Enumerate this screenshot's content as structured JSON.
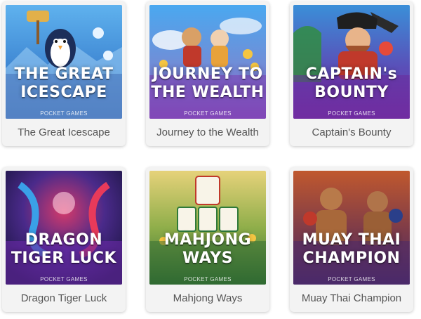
{
  "games": [
    {
      "name": "The Great Icescape",
      "art_lines": [
        "THE GREAT",
        "ICESCAPE"
      ],
      "brand": "POCKET GAMES",
      "icon": "penguin-icon",
      "colors": {
        "sky": "#5aa9e6",
        "base": "#2f6fbf",
        "accent": "#e8f4ff"
      }
    },
    {
      "name": "Journey to the Wealth",
      "art_lines": [
        "JOURNEY TO",
        "THE WEALTH"
      ],
      "brand": "POCKET GAMES",
      "icon": "monkey-king-icon",
      "colors": {
        "sky": "#4aa3ef",
        "base": "#8a4fbf",
        "accent": "#f4c542"
      }
    },
    {
      "name": "Captain's Bounty",
      "art_lines": [
        "CAPTAIN's",
        "BOUNTY"
      ],
      "brand": "POCKET GAMES",
      "icon": "pirate-icon",
      "colors": {
        "sky": "#2f7fc9",
        "base": "#7a2fa8",
        "accent": "#c0392b"
      }
    },
    {
      "name": "Dragon Tiger Luck",
      "art_lines": [
        "DRAGON",
        "TIGER LUCK"
      ],
      "brand": "POCKET GAMES",
      "icon": "dragon-tiger-icon",
      "colors": {
        "sky": "#2a1a6a",
        "base": "#7b2fa8",
        "accent": "#d63a6a"
      }
    },
    {
      "name": "Mahjong Ways",
      "art_lines": [
        "MAHJONG",
        "WAYS"
      ],
      "brand": "POCKET GAMES",
      "icon": "mahjong-tile-icon",
      "colors": {
        "sky": "#d6c25a",
        "base": "#2f7a3a",
        "accent": "#c0392b"
      }
    },
    {
      "name": "Muay Thai Champion",
      "art_lines": [
        "MUAY THAI",
        "CHAMPION"
      ],
      "brand": "POCKET GAMES",
      "icon": "boxer-icon",
      "colors": {
        "sky": "#b04a2a",
        "base": "#5a2a6a",
        "accent": "#e8a06a"
      }
    }
  ]
}
